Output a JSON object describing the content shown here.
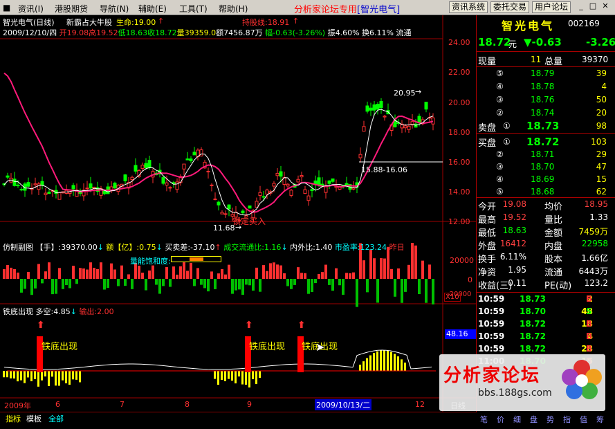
{
  "menu": {
    "items": [
      "资讯(I)",
      "港股期货",
      "导航(N)",
      "辅助(E)",
      "工具(T)",
      "帮助(H)"
    ],
    "center_title": "分析家论坛专用",
    "center_highlight": "[智光电气]",
    "buttons": [
      "资讯系统",
      "委托交易",
      "用户论坛"
    ]
  },
  "chart": {
    "title": "智光电气(日线)",
    "subtitle": "新霸占大牛股",
    "life_label": "生命:19.00",
    "hold_label": "持股线:18.91",
    "info_date": "2009/12/10/四",
    "info_open": "开19.08",
    "info_high": "高19.52",
    "info_low": "低18.63",
    "info_close": "收18.72",
    "info_vol": "量39359.0",
    "info_amt": "额7456.87万",
    "info_range": "幅-0.63(-3.26%)",
    "info_amp": "振4.60%",
    "info_turn": "换6.11%",
    "info_flow": "流通",
    "y_labels": [
      "24.00",
      "22.00",
      "20.00",
      "18.00",
      "16.00",
      "14.00",
      "12.00"
    ],
    "annot_high": "20.95",
    "annot_low": "11.68",
    "annot_range": "15.88-16.06",
    "annot_lock": "锁定买入"
  },
  "vol_panel": {
    "name": "仿制副图",
    "hand": "【手】:39370.00",
    "amount": "额【亿】:0.75",
    "diff": "买卖差:-37.10",
    "flow_ratio": "成交流通比:1.16",
    "inout": "内外比:1.40",
    "pe": "市盈率:123.24",
    "yesterday": "昨日",
    "sat": "量能饱和度:",
    "y_labels": [
      "20000",
      "0",
      "-20000"
    ],
    "x10": "X10"
  },
  "ind_panel": {
    "name": "铁底出现",
    "duo": "多空:4.85",
    "out": "输出:2.00",
    "signal": "铁底出现",
    "value": "48.16"
  },
  "x_axis": {
    "year": "2009年",
    "months": [
      "6",
      "7",
      "8",
      "9",
      "12"
    ],
    "cursor_date": "2009/10/13/二",
    "period": "日线"
  },
  "bottom_tabs": [
    "指标",
    "模板",
    "全部"
  ],
  "quote": {
    "name": "智光电气",
    "code": "002169",
    "price": "18.72",
    "yuan": "元",
    "change": "▼-0.63",
    "pct": "-3.26",
    "now_vol_label": "现量",
    "now_vol": "11",
    "total_vol_label": "总量",
    "total_vol": "39370",
    "sell": [
      {
        "lv": "⑤",
        "price": "18.79",
        "vol": "39"
      },
      {
        "lv": "④",
        "price": "18.78",
        "vol": "4"
      },
      {
        "lv": "③",
        "price": "18.76",
        "vol": "50"
      },
      {
        "lv": "②",
        "price": "18.74",
        "vol": "20"
      },
      {
        "lv": "①",
        "price": "18.73",
        "vol": "98"
      }
    ],
    "sell_label": "卖盘",
    "buy_label": "买盘",
    "buy": [
      {
        "lv": "①",
        "price": "18.72",
        "vol": "103"
      },
      {
        "lv": "②",
        "price": "18.71",
        "vol": "29"
      },
      {
        "lv": "③",
        "price": "18.70",
        "vol": "47"
      },
      {
        "lv": "④",
        "price": "18.69",
        "vol": "15"
      },
      {
        "lv": "⑤",
        "price": "18.68",
        "vol": "62"
      }
    ],
    "stats": [
      {
        "l1": "今开",
        "v1": "19.08",
        "l2": "均价",
        "v2": "18.95",
        "c1": "#ff4040",
        "c2": "#ff4040"
      },
      {
        "l1": "最高",
        "v1": "19.52",
        "l2": "量比",
        "v2": "1.33",
        "c1": "#ff4040",
        "c2": "#ffffff"
      },
      {
        "l1": "最低",
        "v1": "18.63",
        "l2": "金额",
        "v2": "7459万",
        "c1": "#00ff00",
        "c2": "#ffff00"
      },
      {
        "l1": "外盘",
        "v1": "16412",
        "l2": "内盘",
        "v2": "22958",
        "c1": "#ff4040",
        "c2": "#00ff00"
      },
      {
        "l1": "换手",
        "v1": "6.11%",
        "l2": "股本",
        "v2": "1.66亿",
        "c1": "#ffffff",
        "c2": "#ffffff"
      },
      {
        "l1": "净资",
        "v1": "1.95",
        "l2": "流通",
        "v2": "6443万",
        "c1": "#ffffff",
        "c2": "#ffffff"
      },
      {
        "l1": "收益(三)",
        "v1": "0.11",
        "l2": "PE(动)",
        "v2": "123.2",
        "c1": "#ffffff",
        "c2": "#ffffff"
      }
    ],
    "ticks": [
      {
        "t": "10:59",
        "p": "18.73",
        "v": "2",
        "s": "B"
      },
      {
        "t": "10:59",
        "p": "18.70",
        "v": "48",
        "s": "S"
      },
      {
        "t": "10:59",
        "p": "18.72",
        "v": "18",
        "s": "B"
      },
      {
        "t": "10:59",
        "p": "18.72",
        "v": "4",
        "s": "B"
      },
      {
        "t": "10:59",
        "p": "18.72",
        "v": "28",
        "s": "B"
      },
      {
        "t": "11:00",
        "p": "18.70",
        "v": "15",
        "s": "B"
      }
    ],
    "side_tabs": [
      "笔",
      "价",
      "细",
      "盘",
      "势",
      "指",
      "值",
      "筹"
    ]
  },
  "watermark": {
    "text": "分析家论坛",
    "url": "bbs.188gs.com"
  },
  "colors": {
    "up": "#ff3030",
    "down": "#00ff00",
    "ma": "#ff1a7a",
    "yellow": "#ffff00",
    "cyan": "#00ffff"
  }
}
